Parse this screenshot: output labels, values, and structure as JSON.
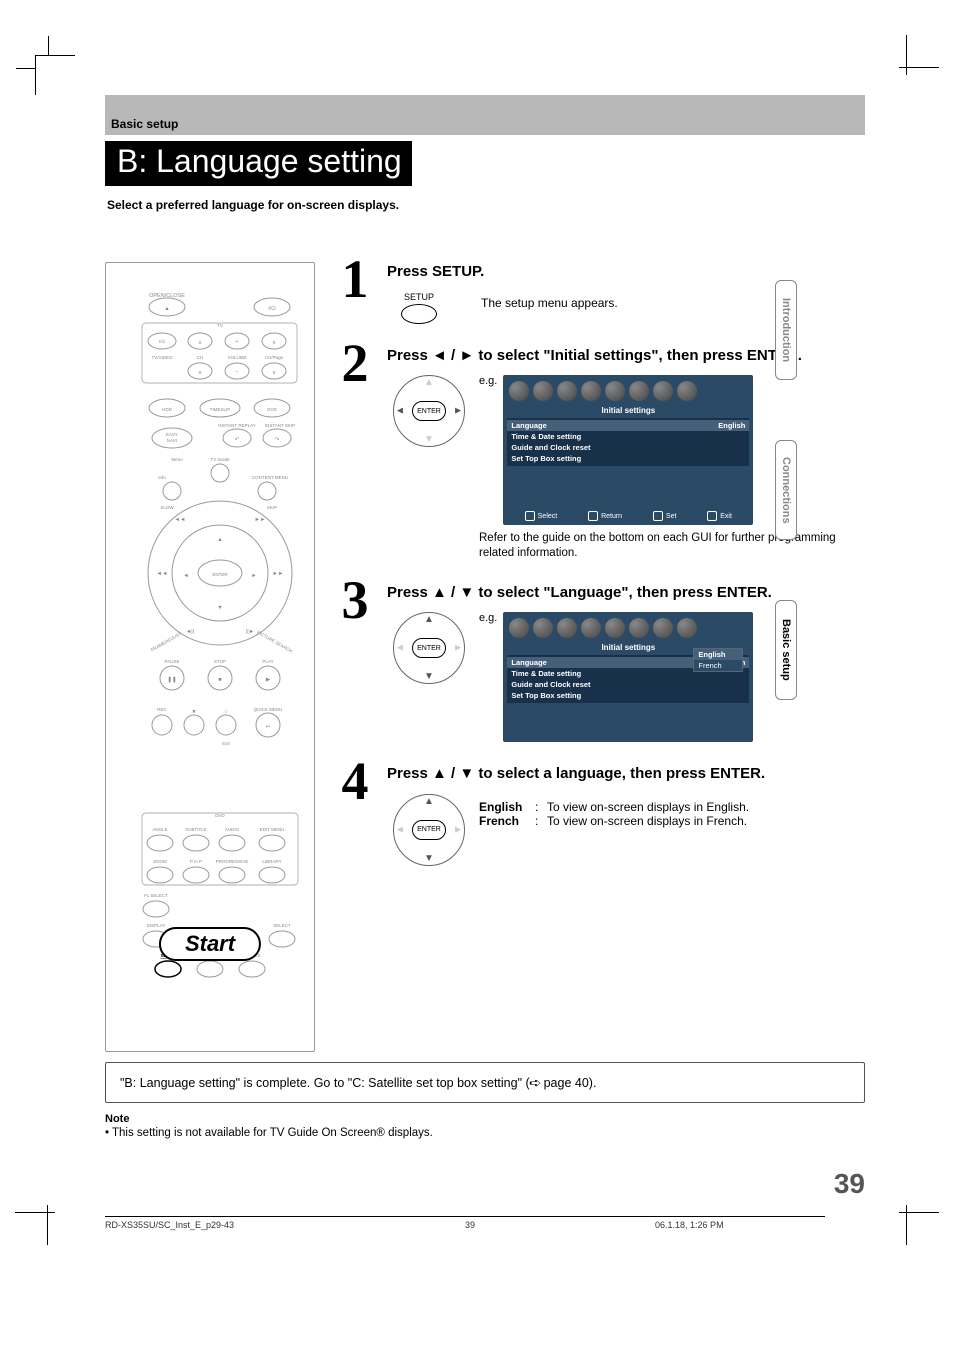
{
  "header": {
    "section": "Basic setup",
    "title": "B: Language setting",
    "subtitle": "Select a preferred language for on-screen displays."
  },
  "side_tabs": [
    "Introduction",
    "Connections",
    "Basic setup"
  ],
  "remote": {
    "labels": {
      "open_close": "OPEN/CLOSE",
      "tv": "TV",
      "tv_video": "TV/VIDEO",
      "ch": "CH",
      "volume": "VOLUME",
      "ch_page": "CH/Page",
      "hdd": "HDD",
      "timeslip": "TIMESLIP",
      "dvd": "DVD",
      "instant_replay": "INSTANT REPLAY",
      "instant_skip": "INSTANT SKIP",
      "easy_navi": "EASY\nNAVI",
      "menu": "Menu",
      "tv_guide": "TV Guide",
      "info": "Info",
      "content_menu": "CONTENT MENU",
      "slow": "SLOW",
      "skip": "SKIP",
      "enter": "ENTER",
      "frame_adjust": "FRAME/ADJUST",
      "picture_search": "PICTURE SEARCH",
      "pause": "PAUSE",
      "stop": "STOP",
      "play": "PLAY",
      "rec": "REC",
      "quick_menu": "QUICK MENU",
      "exit": "Exit",
      "dvd_section": "DVD",
      "angle": "ANGLE",
      "subtitle": "SUBTITLE",
      "audio": "AUDIO",
      "edit_menu": "EDIT MENU",
      "zoom": "ZOOM",
      "pinp": "P in P",
      "progressive": "PROGRESSIVE",
      "library": "LIBRARY",
      "fl_select": "FL SELECT",
      "display": "DISPLAY",
      "tv_guide2": "TV GUIDE",
      "select": "SELECT",
      "setup": "SETUP",
      "clear": "CLEAR",
      "delete": "DELETE"
    },
    "callout": "Start"
  },
  "steps": [
    {
      "num": "1",
      "title": "Press SETUP.",
      "desc": "The setup menu appears.",
      "btn_label": "SETUP"
    },
    {
      "num": "2",
      "title": "Press ◄ / ► to select \"Initial settings\", then press ENTER.",
      "eg": "e.g.",
      "enter": "ENTER",
      "gui": {
        "title": "Initial settings",
        "rows": [
          {
            "label": "Language",
            "value": "English",
            "sel": true
          },
          {
            "label": "Time & Date setting"
          },
          {
            "label": "Guide and Clock reset"
          },
          {
            "label": "Set Top Box setting"
          }
        ],
        "footer": [
          "Select",
          "Return",
          "Set",
          "Exit"
        ]
      },
      "hint": "Refer to the guide on the bottom on each GUI for further programming related information."
    },
    {
      "num": "3",
      "title": "Press ▲ / ▼ to select \"Language\", then press ENTER.",
      "eg": "e.g.",
      "enter": "ENTER",
      "gui": {
        "title": "Initial settings",
        "rows": [
          {
            "label": "Language",
            "value": "English",
            "sel": true
          },
          {
            "label": "Time & Date setting"
          },
          {
            "label": "Guide and Clock reset"
          },
          {
            "label": "Set Top Box setting"
          }
        ],
        "popup": [
          "English",
          "French"
        ]
      }
    },
    {
      "num": "4",
      "title": "Press ▲ / ▼ to select a language, then press ENTER.",
      "enter": "ENTER",
      "options": [
        {
          "k": "English",
          "v": "To view on-screen displays in English."
        },
        {
          "k": "French",
          "v": "To view on-screen displays in French."
        }
      ]
    }
  ],
  "completion": {
    "text_pre": "\"B: Language setting\" is complete. Go to \"C: Satellite set top box setting\" (",
    "text_post": " page 40)."
  },
  "note": {
    "title": "Note",
    "body": "• This setting is not available for TV Guide On Screen® displays."
  },
  "page_number": "39",
  "footer": {
    "file": "RD-XS35SU/SC_Inst_E_p29-43",
    "page": "39",
    "timestamp": "06.1.18, 1:26 PM"
  }
}
